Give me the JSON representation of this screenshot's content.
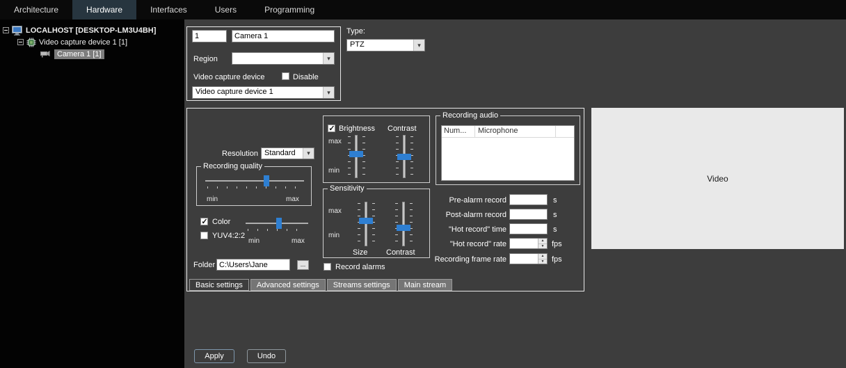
{
  "topbar": {
    "tabs": [
      {
        "label": "Architecture",
        "active": false
      },
      {
        "label": "Hardware",
        "active": true
      },
      {
        "label": "Interfaces",
        "active": false
      },
      {
        "label": "Users",
        "active": false
      },
      {
        "label": "Programming",
        "active": false
      }
    ]
  },
  "tree": {
    "items": [
      {
        "label": "LOCALHOST [DESKTOP-LM3U4BH]",
        "selected": false
      },
      {
        "label": "Video capture device 1 [1]",
        "selected": false
      },
      {
        "label": "Camera 1 [1]",
        "selected": true
      }
    ]
  },
  "id_panel": {
    "id_value": "1",
    "name_value": "Camera 1",
    "region_label": "Region",
    "region_value": "",
    "device_label": "Video capture device",
    "disable_label": "Disable",
    "disable_checked": false,
    "device_value": "Video capture device 1"
  },
  "type_panel": {
    "label": "Type:",
    "value": "PTZ"
  },
  "settings": {
    "resolution_label": "Resolution",
    "resolution_value": "Standard",
    "recording_quality": {
      "title": "Recording quality",
      "min_label": "min",
      "max_label": "max",
      "position": "62%"
    },
    "color": {
      "label": "Color",
      "checked": true
    },
    "yuv": {
      "label": "YUV4:2:2",
      "checked": false
    },
    "color_slider": {
      "min_label": "min",
      "max_label": "max",
      "position": "53%"
    },
    "folder_label": "Folder",
    "folder_value": "C:\\Users\\Jane",
    "browse_label": "...",
    "tabs": [
      {
        "label": "Basic settings",
        "active": true
      },
      {
        "label": "Advanced settings",
        "active": false
      },
      {
        "label": "Streams settings",
        "active": false
      },
      {
        "label": "Main stream",
        "active": false
      }
    ],
    "brightness_group": {
      "brightness_label": "Brightness",
      "brightness_checked": true,
      "contrast_label": "Contrast",
      "max_label": "max",
      "min_label": "min",
      "brightness_position": "43%",
      "contrast_position": "50%"
    },
    "sensitivity_group": {
      "title": "Sensitivity",
      "max_label": "max",
      "min_label": "min",
      "size_label": "Size",
      "contrast_label": "Contrast",
      "size_position": "42%",
      "contrast_position": "58%"
    },
    "record_alarms": {
      "label": "Record alarms",
      "checked": false
    },
    "recording_audio": {
      "title": "Recording audio",
      "columns": [
        "Num...",
        "Microphone"
      ]
    },
    "fields": [
      {
        "label": "Pre-alarm record",
        "value": "",
        "unit": "s"
      },
      {
        "label": "Post-alarm record",
        "value": "",
        "unit": "s"
      },
      {
        "label": "\"Hot record\" time",
        "value": "",
        "unit": "s"
      },
      {
        "label": "\"Hot record\" rate",
        "value": "",
        "unit": "fps"
      },
      {
        "label": "Recording frame rate",
        "value": "",
        "unit": "fps"
      }
    ]
  },
  "video_panel": {
    "label": "Video"
  },
  "footer": {
    "apply_label": "Apply",
    "undo_label": "Undo"
  },
  "colors": {
    "accent_blue": "#2e7fd2",
    "selection_gray": "#7d7d7d",
    "video_bg": "#e9e9e9",
    "tab_active_bg": "#27353f"
  }
}
